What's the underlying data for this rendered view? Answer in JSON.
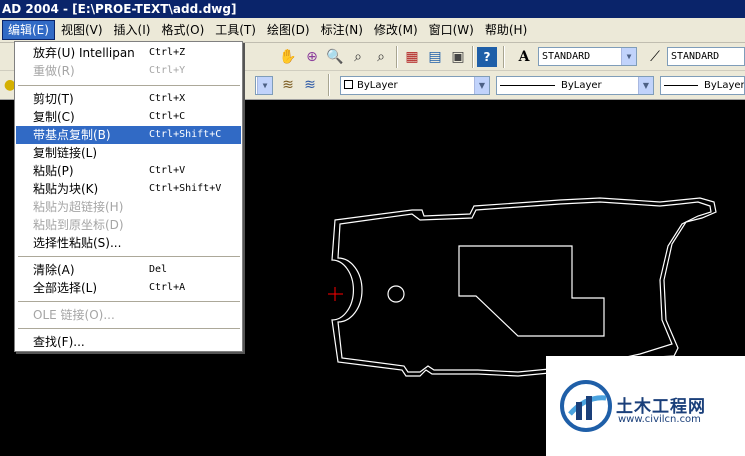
{
  "window": {
    "title": "AD 2004 - [E:\\PROE-TEXT\\add.dwg]"
  },
  "menubar": [
    {
      "label": "编辑(E)",
      "active": true
    },
    {
      "label": "视图(V)"
    },
    {
      "label": "插入(I)"
    },
    {
      "label": "格式(O)"
    },
    {
      "label": "工具(T)"
    },
    {
      "label": "绘图(D)"
    },
    {
      "label": "标注(N)"
    },
    {
      "label": "修改(M)"
    },
    {
      "label": "窗口(W)"
    },
    {
      "label": "帮助(H)"
    }
  ],
  "edit_menu": [
    {
      "label": "放弃(U) Intellipan",
      "shortcut": "Ctrl+Z",
      "disabled": false
    },
    {
      "label": "重做(R)",
      "shortcut": "Ctrl+Y",
      "disabled": true
    },
    {
      "label": "剪切(T)",
      "shortcut": "Ctrl+X",
      "disabled": false
    },
    {
      "label": "复制(C)",
      "shortcut": "Ctrl+C",
      "disabled": false
    },
    {
      "label": "带基点复制(B)",
      "shortcut": "Ctrl+Shift+C",
      "disabled": false,
      "highlighted": true
    },
    {
      "label": "复制链接(L)",
      "shortcut": "",
      "disabled": false
    },
    {
      "label": "粘贴(P)",
      "shortcut": "Ctrl+V",
      "disabled": false
    },
    {
      "label": "粘贴为块(K)",
      "shortcut": "Ctrl+Shift+V",
      "disabled": false
    },
    {
      "label": "粘贴为超链接(H)",
      "shortcut": "",
      "disabled": true
    },
    {
      "label": "粘贴到原坐标(D)",
      "shortcut": "",
      "disabled": true
    },
    {
      "label": "选择性粘贴(S)...",
      "shortcut": "",
      "disabled": false
    },
    {
      "label": "清除(A)",
      "shortcut": "Del",
      "disabled": false
    },
    {
      "label": "全部选择(L)",
      "shortcut": "Ctrl+A",
      "disabled": false
    },
    {
      "label": "OLE 链接(O)...",
      "shortcut": "",
      "disabled": true
    },
    {
      "label": "查找(F)...",
      "shortcut": "",
      "disabled": false
    }
  ],
  "toolbar": {
    "text_style": "STANDARD",
    "dim_style": "STANDARD",
    "color": "ByLayer",
    "linetype": "ByLayer",
    "lineweight": "ByLayer"
  },
  "icons": {
    "pan": "hand-icon",
    "zoom_realtime": "zoom-realtime-icon",
    "zoom_window": "zoom-window-icon",
    "zoom_previous": "zoom-previous-icon",
    "properties": "properties-icon",
    "design_center": "design-center-icon",
    "tool_palettes": "tool-palettes-icon",
    "help": "help-icon",
    "text_style": "text-style-icon",
    "dim_style": "dim-style-icon",
    "layer_state": "layer-state-icon",
    "layer_previous": "layer-previous-icon"
  },
  "watermark": {
    "title": "土木工程网",
    "url": "www.civilcn.com"
  },
  "colors": {
    "menu_highlight": "#316ac5",
    "drawing_bg": "#000000",
    "drawing_lines": "#ffffff",
    "crosshair": "#ff0000"
  }
}
